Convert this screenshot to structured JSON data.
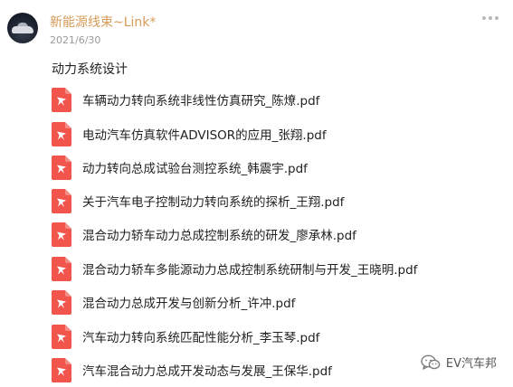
{
  "post": {
    "author": "新能源线束~Link*",
    "date": "2021/6/30",
    "heading": "动力系统设计"
  },
  "files": [
    {
      "name": "车辆动力转向系统非线性仿真研究_陈燎.pdf",
      "icon": "pdf-icon"
    },
    {
      "name": "电动汽车仿真软件ADVISOR的应用_张翔.pdf",
      "icon": "pdf-icon"
    },
    {
      "name": "动力转向总成试验台测控系统_韩震宇.pdf",
      "icon": "pdf-icon"
    },
    {
      "name": "关于汽车电子控制动力转向系统的探析_王翔.pdf",
      "icon": "pdf-icon"
    },
    {
      "name": "混合动力轿车动力总成控制系统的研发_廖承林.pdf",
      "icon": "pdf-icon"
    },
    {
      "name": "混合动力轿车多能源动力总成控制系统研制与开发_王晓明.pdf",
      "icon": "pdf-icon"
    },
    {
      "name": "混合动力总成开发与创新分析_许冲.pdf",
      "icon": "pdf-icon"
    },
    {
      "name": "汽车动力转向系统匹配性能分析_李玉琴.pdf",
      "icon": "pdf-icon"
    },
    {
      "name": "汽车混合动力总成开发动态与发展_王保华.pdf",
      "icon": "pdf-icon"
    }
  ],
  "watermark": {
    "label": "EV汽车邦",
    "icon": "wechat-icon"
  },
  "colors": {
    "author": "#d79a57",
    "pdf_red": "#f1554c",
    "date": "#9a9a9a"
  }
}
